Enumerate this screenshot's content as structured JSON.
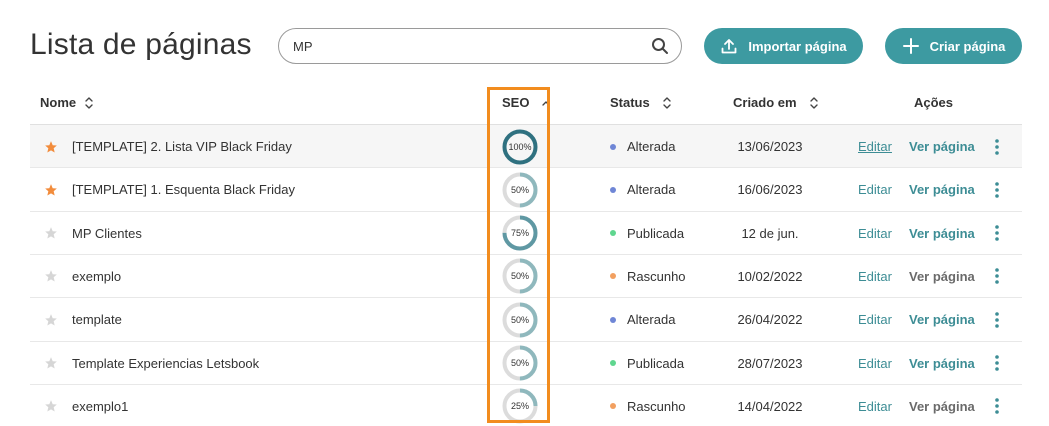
{
  "header": {
    "title": "Lista de páginas",
    "search_value": "MP",
    "import_label": "Importar página",
    "create_label": "Criar página"
  },
  "table": {
    "col_name": "Nome",
    "col_seo": "SEO",
    "col_status": "Status",
    "col_created": "Criado em",
    "col_actions": "Ações",
    "edit_label": "Editar",
    "view_label": "Ver página",
    "rows": [
      {
        "starred": true,
        "name": "[TEMPLATE] 2. Lista VIP Black Friday",
        "seo": 100,
        "seo_label": "100%",
        "status": "Alterada",
        "status_color": "#6f86d6",
        "date": "13/06/2023"
      },
      {
        "starred": true,
        "name": "[TEMPLATE] 1. Esquenta Black Friday",
        "seo": 50,
        "seo_label": "50%",
        "status": "Alterada",
        "status_color": "#6f86d6",
        "date": "16/06/2023"
      },
      {
        "starred": false,
        "name": "MP Clientes",
        "seo": 75,
        "seo_label": "75%",
        "status": "Publicada",
        "status_color": "#5fd68f",
        "date": "12 de jun."
      },
      {
        "starred": false,
        "name": "exemplo",
        "seo": 50,
        "seo_label": "50%",
        "status": "Rascunho",
        "status_color": "#f2a060",
        "date": "10/02/2022"
      },
      {
        "starred": false,
        "name": "template",
        "seo": 50,
        "seo_label": "50%",
        "status": "Alterada",
        "status_color": "#6f86d6",
        "date": "26/04/2022"
      },
      {
        "starred": false,
        "name": "Template Experiencias Letsbook",
        "seo": 50,
        "seo_label": "50%",
        "status": "Publicada",
        "status_color": "#5fd68f",
        "date": "28/07/2023"
      },
      {
        "starred": false,
        "name": "exemplo1",
        "seo": 25,
        "seo_label": "25%",
        "status": "Rascunho",
        "status_color": "#f2a060",
        "date": "14/04/2022"
      }
    ]
  },
  "colors": {
    "accent": "#3d9aa1",
    "star_on": "#f28c3c",
    "star_off": "#d6d6d6",
    "seo_full": "#2f7180",
    "seo_partial": "#8fb8bd",
    "seo_track": "#dcdcdc",
    "highlight": "#f28c1e"
  },
  "icons": {
    "search": "search-icon",
    "import": "upload-icon",
    "create": "plus-icon",
    "sort": "sort-icon",
    "star": "star-icon",
    "more": "more-vertical-icon"
  }
}
